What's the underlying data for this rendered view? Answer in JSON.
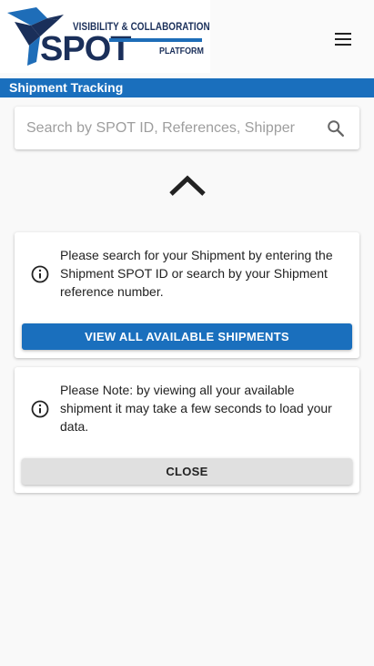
{
  "header": {
    "logo_wordmark": "SPOT",
    "logo_tagline_line1": "VISIBILITY & COLLABORATION",
    "logo_tagline_line2": "PLATFORM",
    "menu_icon": "hamburger-menu-icon"
  },
  "section": {
    "title": "Shipment Tracking"
  },
  "search": {
    "placeholder": "Search by SPOT ID, References, Shipper",
    "value": "",
    "icon": "search-icon"
  },
  "collapse": {
    "icon": "chevron-up-icon"
  },
  "info_card": {
    "icon": "info-icon",
    "text": "Please search for your Shipment by entering the Shipment SPOT ID or search by your Shipment reference number.",
    "button_label": "VIEW ALL AVAILABLE SHIPMENTS"
  },
  "note_card": {
    "icon": "info-icon",
    "text": "Please Note: by viewing all your available shipment it may take a few seconds to load your data.",
    "button_label": "CLOSE"
  },
  "colors": {
    "primary": "#1a6fbd",
    "logo_navy": "#1a2f5a",
    "button_grey": "#e0e0e0",
    "background": "#f9f9f9"
  }
}
